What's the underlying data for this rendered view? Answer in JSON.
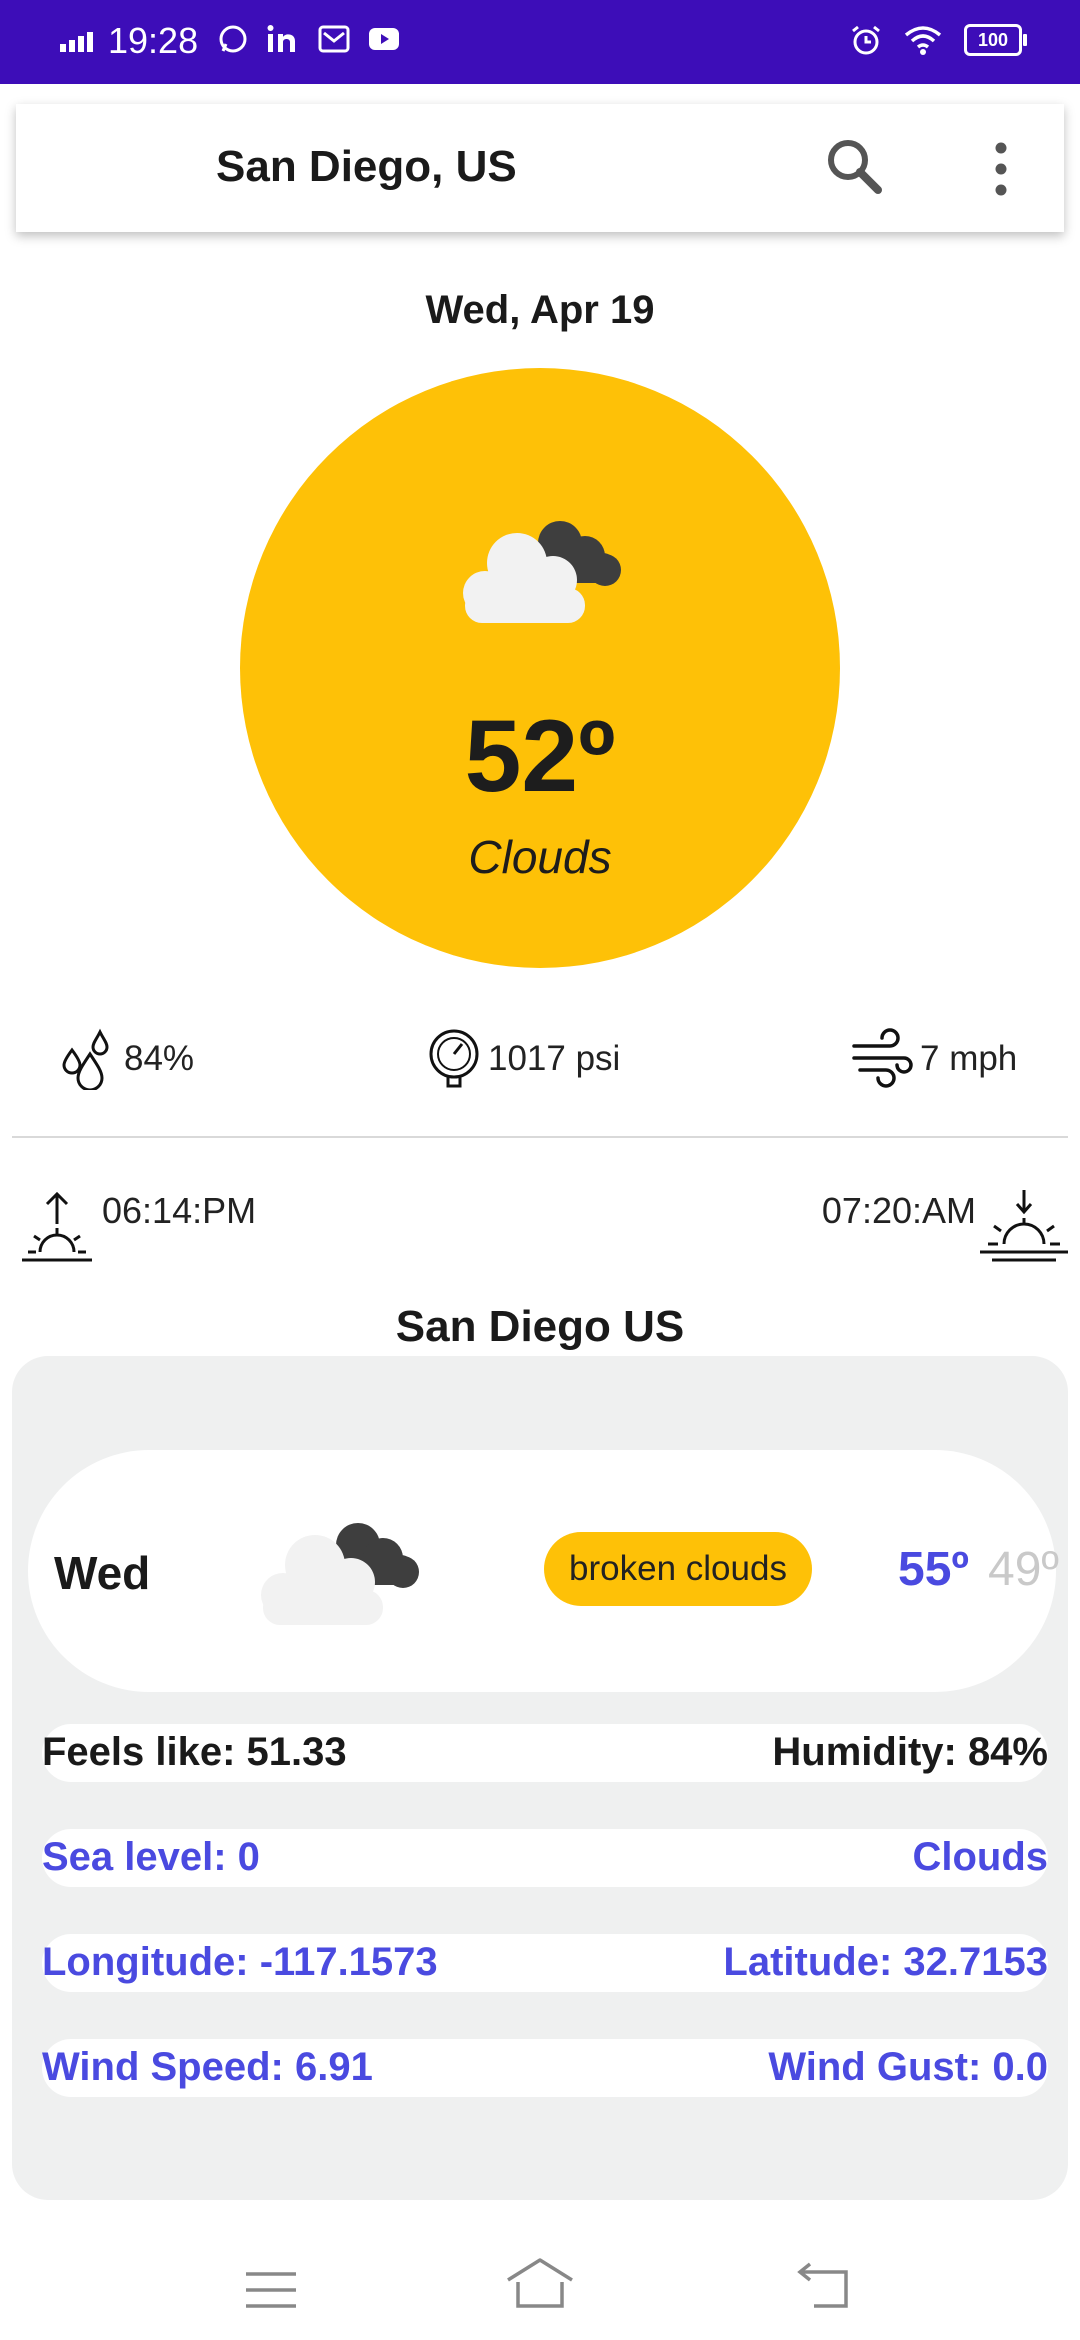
{
  "status_bar": {
    "time": "19:28",
    "battery": "100",
    "colors": {
      "background": "#3d0db8"
    }
  },
  "header": {
    "city": "San Diego,  US"
  },
  "current": {
    "date": "Wed, Apr 19",
    "temperature": "52º",
    "condition": "Clouds",
    "circle_color": "#fec107"
  },
  "stats": {
    "humidity": "84%",
    "pressure": "1017 psi",
    "wind": "7 mph"
  },
  "sun": {
    "sunrise_label": "06:14:PM",
    "sunset_label": "07:20:AM"
  },
  "location_title": "San Diego US",
  "forecast": {
    "day": "Wed",
    "description": "broken clouds",
    "high": "55º",
    "low": "49º",
    "accent": "#4a4ae0"
  },
  "details": {
    "feels_like": "Feels like: 51.33",
    "humidity": "Humidity: 84%",
    "sea_level": "Sea level: 0",
    "main": "Clouds",
    "longitude": "Longitude: -117.1573",
    "latitude": "Latitude: 32.7153",
    "wind_speed": "Wind Speed: 6.91",
    "wind_gust": "Wind Gust: 0.0"
  }
}
